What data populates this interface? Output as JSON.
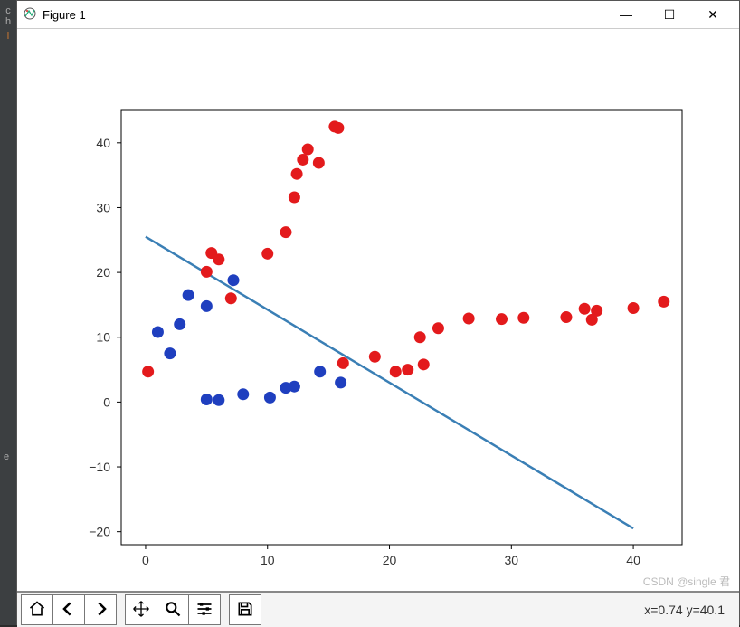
{
  "sidebar_letters": [
    "c",
    "h",
    "i",
    "e"
  ],
  "window": {
    "title": "Figure 1",
    "minimize_glyph": "—",
    "maximize_glyph": "☐",
    "close_glyph": "✕"
  },
  "toolbar": {
    "home_label": "Home",
    "back_label": "Back",
    "forward_label": "Forward",
    "pan_label": "Pan",
    "zoom_label": "Zoom",
    "config_label": "Configure",
    "save_label": "Save"
  },
  "status": {
    "coord_text": "x=0.74  y=40.1"
  },
  "watermark": "CSDN @single 君",
  "chart_data": {
    "type": "scatter",
    "title": "",
    "xlabel": "",
    "ylabel": "",
    "xlim": [
      -2,
      44
    ],
    "ylim": [
      -22,
      45
    ],
    "xticks": [
      0,
      10,
      20,
      30,
      40
    ],
    "yticks": [
      -20,
      -10,
      0,
      10,
      20,
      30,
      40
    ],
    "series": [
      {
        "name": "blue_points",
        "color": "#1f3fbf",
        "marker": "o",
        "points": [
          {
            "x": 1.0,
            "y": 10.8
          },
          {
            "x": 2.0,
            "y": 7.5
          },
          {
            "x": 2.8,
            "y": 12.0
          },
          {
            "x": 3.5,
            "y": 16.5
          },
          {
            "x": 5.0,
            "y": 14.8
          },
          {
            "x": 5.0,
            "y": 0.4
          },
          {
            "x": 6.0,
            "y": 0.3
          },
          {
            "x": 7.2,
            "y": 18.8
          },
          {
            "x": 8.0,
            "y": 1.2
          },
          {
            "x": 10.2,
            "y": 0.7
          },
          {
            "x": 11.5,
            "y": 2.2
          },
          {
            "x": 12.2,
            "y": 2.4
          },
          {
            "x": 14.3,
            "y": 4.7
          },
          {
            "x": 16.0,
            "y": 3.0
          }
        ]
      },
      {
        "name": "red_points",
        "color": "#e31a1c",
        "marker": "o",
        "points": [
          {
            "x": 0.2,
            "y": 4.7
          },
          {
            "x": 5.0,
            "y": 20.1
          },
          {
            "x": 5.4,
            "y": 23.0
          },
          {
            "x": 6.0,
            "y": 22.0
          },
          {
            "x": 7.0,
            "y": 16.0
          },
          {
            "x": 10.0,
            "y": 22.9
          },
          {
            "x": 11.5,
            "y": 26.2
          },
          {
            "x": 12.2,
            "y": 31.6
          },
          {
            "x": 12.4,
            "y": 35.2
          },
          {
            "x": 12.9,
            "y": 37.4
          },
          {
            "x": 13.3,
            "y": 39.0
          },
          {
            "x": 14.2,
            "y": 36.9
          },
          {
            "x": 15.5,
            "y": 42.5
          },
          {
            "x": 15.8,
            "y": 42.3
          },
          {
            "x": 16.2,
            "y": 6.0
          },
          {
            "x": 18.8,
            "y": 7.0
          },
          {
            "x": 20.5,
            "y": 4.7
          },
          {
            "x": 21.5,
            "y": 5.0
          },
          {
            "x": 22.8,
            "y": 5.8
          },
          {
            "x": 22.5,
            "y": 10.0
          },
          {
            "x": 24.0,
            "y": 11.4
          },
          {
            "x": 26.5,
            "y": 12.9
          },
          {
            "x": 29.2,
            "y": 12.8
          },
          {
            "x": 31.0,
            "y": 13.0
          },
          {
            "x": 34.5,
            "y": 13.1
          },
          {
            "x": 36.0,
            "y": 14.4
          },
          {
            "x": 36.6,
            "y": 12.7
          },
          {
            "x": 37.0,
            "y": 14.1
          },
          {
            "x": 40.0,
            "y": 14.5
          },
          {
            "x": 42.5,
            "y": 15.5
          }
        ]
      }
    ],
    "line": {
      "name": "fit_line",
      "color": "#3a7fb5",
      "p1": {
        "x": 0.0,
        "y": 25.5
      },
      "p2": {
        "x": 40.0,
        "y": -19.5
      }
    }
  }
}
